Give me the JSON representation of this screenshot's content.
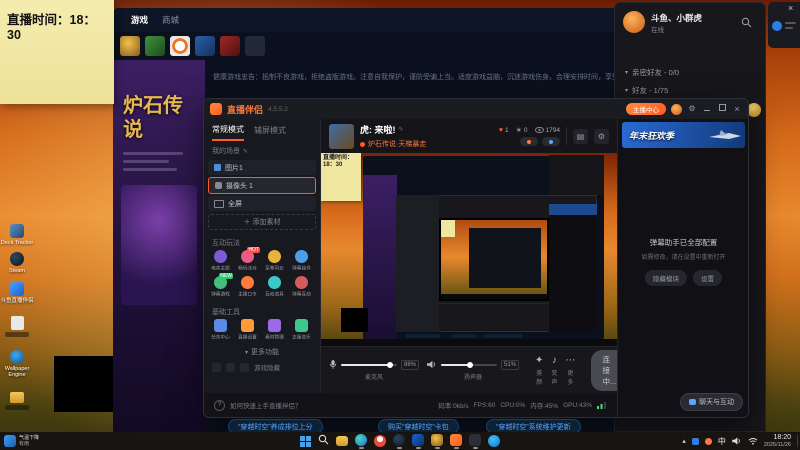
{
  "colors": {
    "accent": "#ff5d23",
    "news_link": "#58a6ff",
    "banner_blue": "#1d4a8f"
  },
  "sticky": {
    "text": "直播时间：18：30"
  },
  "desktop": {
    "icons": [
      {
        "label": "Deck Tracker"
      },
      {
        "label": "Steam"
      },
      {
        "label": "斗鱼直播伴侣"
      },
      {
        "label": "Wallpaper Engine"
      }
    ]
  },
  "launcher": {
    "tabs": [
      {
        "label": "游戏"
      },
      {
        "label": "商城"
      }
    ],
    "health": "健康游戏忠告：抵制不良游戏，拒绝盗版游戏。注意自我保护，谨防受骗上当。适度游戏益脑，沉迷游戏伤身。合理安排时间，享受健康生活。",
    "promo_title": "炉石传说",
    "news": [
      {
        "label": "“穿越时空”养成排位上分"
      },
      {
        "label": "购买“穿越时空”卡包"
      },
      {
        "label": "“穿越时空”系统维护更新"
      }
    ]
  },
  "client": {
    "username": "斗鱼、小群虎",
    "status": "在线",
    "groups": [
      {
        "label": "亲密好友 - 0/0"
      },
      {
        "label": "好友 - 1/75"
      }
    ]
  },
  "companion": {
    "title": "直播伴侣",
    "version": "4.5.5.2",
    "anchor_center": "主播中心",
    "tabs": {
      "normal": "常规模式",
      "secondary": "辅屏模式"
    },
    "scenes": {
      "header": "我的场景",
      "add": "＋ 添加素材",
      "items": [
        {
          "label": "图片1"
        },
        {
          "label": "摄像头 1"
        },
        {
          "label": "全屏"
        }
      ]
    },
    "interact": {
      "header": "互动玩法",
      "items": [
        {
          "label": "电音主题"
        },
        {
          "label": "畅玩派对",
          "badge": "HOT"
        },
        {
          "label": "至尊风云"
        },
        {
          "label": "弹幕挂件"
        },
        {
          "label": "弹幕游戏",
          "badge": "NEW"
        },
        {
          "label": "主播口令"
        },
        {
          "label": "互动道具"
        },
        {
          "label": "弹幕互动"
        }
      ]
    },
    "tools": {
      "header": "基础工具",
      "more": "更多功能",
      "hide_game": "游戏隐藏",
      "items": [
        {
          "label": "任务中心"
        },
        {
          "label": "直播设置"
        },
        {
          "label": "素材管理"
        },
        {
          "label": "正版音乐"
        }
      ]
    },
    "room": {
      "title": "虎: 来啦!",
      "category": "炉石传说·天梯暴走",
      "stats": [
        {
          "value": "1"
        },
        {
          "value": "0"
        },
        {
          "value": "1794"
        }
      ]
    },
    "audio": {
      "mic_label": "麦克风",
      "mic_value": "88%",
      "spk_label": "扬声器",
      "spk_value": "51%",
      "beauty": "美颜",
      "voice": "变声",
      "more": "更多",
      "connect": "连接中..."
    },
    "status": {
      "help": "如何快速上手直播伴侣？",
      "bitrate": "码率:0kb/s",
      "fps": "FPS:60",
      "cpu": "CPU:0%",
      "mem": "内存:45%",
      "gpu": "GPU:43%"
    },
    "panel": {
      "banner": "年末狂欢季",
      "tip_title": "弹幕助手已全部配置",
      "tip_sub": "如需修改，请在设置中重新打开",
      "hide_btn": "隐藏模块",
      "settings_btn": "设置",
      "chat_btn": "聊天与互动"
    }
  },
  "mini": {
    "sticky": "直播时间：18：30"
  },
  "taskbar": {
    "weather1": "气温下降",
    "weather2": "有雨",
    "ime": "中",
    "time": "18:20",
    "date": "2025/11/26"
  }
}
